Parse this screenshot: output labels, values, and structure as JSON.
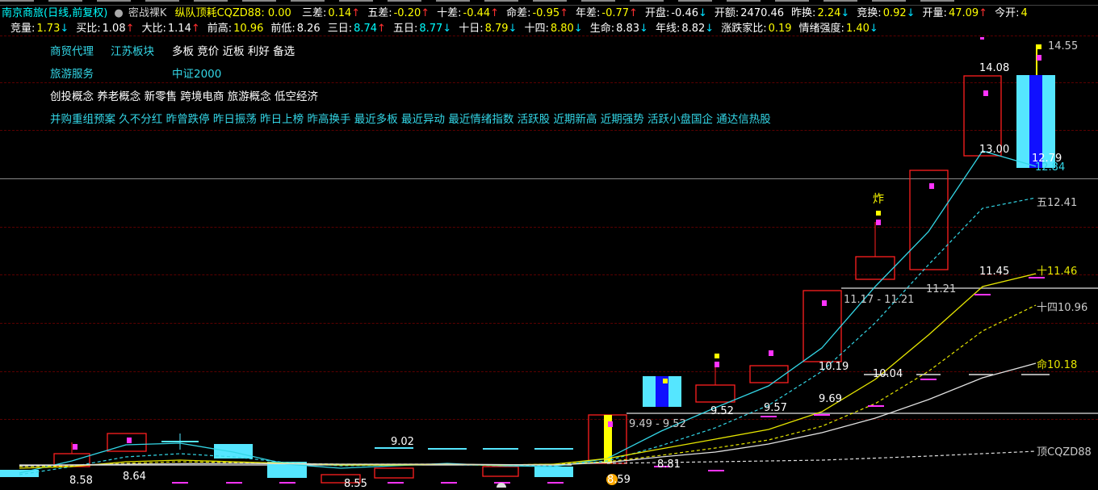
{
  "header": {
    "stock_title": "南京商旅(日线,前复权)",
    "indicator_name": "密战裸K",
    "main_metric": "纵队顶耗CQZD88: 0.00"
  },
  "stats_row1": [
    {
      "label": "三差:",
      "value": "0.14",
      "arrow": "↑",
      "color": "#ffff00"
    },
    {
      "label": "五差:",
      "value": "-0.20",
      "arrow": "↑",
      "color": "#ffff00"
    },
    {
      "label": "十差:",
      "value": "-0.44",
      "arrow": "↑",
      "color": "#ffff00"
    },
    {
      "label": "命差:",
      "value": "-0.95",
      "arrow": "↑",
      "color": "#ffff00"
    },
    {
      "label": "年差:",
      "value": "-0.77",
      "arrow": "↑",
      "color": "#ffff00"
    },
    {
      "label": "开盘:",
      "value": "-0.46",
      "arrow": "↓",
      "color": "#ffffff"
    },
    {
      "label": "开额:",
      "value": "2470.46",
      "arrow": "",
      "color": "#ffffff"
    },
    {
      "label": "昨换:",
      "value": "2.24",
      "arrow": "↓",
      "color": "#ffff00"
    },
    {
      "label": "竞换:",
      "value": "0.92",
      "arrow": "↓",
      "color": "#ffff00"
    },
    {
      "label": "开量:",
      "value": "47.09",
      "arrow": "↑",
      "color": "#ffff00"
    },
    {
      "label": "今开:",
      "value": "4",
      "arrow": "",
      "color": "#ffff00"
    }
  ],
  "stats_row2": [
    {
      "label": "竞量:",
      "value": "1.73",
      "arrow": "↓",
      "color": "#ffff00"
    },
    {
      "label": "买比:",
      "value": "1.08",
      "arrow": "↑",
      "color": "#ffffff"
    },
    {
      "label": "大比:",
      "value": "1.14",
      "arrow": "↑",
      "color": "#ffffff"
    },
    {
      "label": "前高:",
      "value": "10.96",
      "arrow": "",
      "color": "#ffff00"
    },
    {
      "label": "前低:",
      "value": "8.26",
      "arrow": "",
      "color": "#ffffff"
    },
    {
      "label": "三日:",
      "value": "8.74",
      "arrow": "↑",
      "color": "#00ffff"
    },
    {
      "label": "五日:",
      "value": "8.77",
      "arrow": "↓",
      "color": "#00ffff"
    },
    {
      "label": "十日:",
      "value": "8.79",
      "arrow": "↓",
      "color": "#ffff00"
    },
    {
      "label": "十四:",
      "value": "8.80",
      "arrow": "↓",
      "color": "#ffff00"
    },
    {
      "label": "生命:",
      "value": "8.83",
      "arrow": "↓",
      "color": "#ffffff"
    },
    {
      "label": "年线:",
      "value": "8.82",
      "arrow": "↓",
      "color": "#ffffff"
    },
    {
      "label": "涨跌家比:",
      "value": "0.19",
      "arrow": "",
      "color": "#ffff00"
    },
    {
      "label": "情绪强度:",
      "value": "1.40",
      "arrow": "↓",
      "color": "#ffff00"
    }
  ],
  "tags": {
    "industry": "商贸代理",
    "region": "江苏板块",
    "features": "多板 竞价 近板 利好 备选",
    "sector": "旅游服务",
    "index": "中证2000",
    "concepts": "创投概念 养老概念 新零售 跨境电商 旅游概念 低空经济",
    "hot": "并购重组预案 久不分红 昨曾跌停 昨日振荡 昨日上榜 昨高换手 最近多板 最近异动 最近情绪指数 活跃股 近期新高 近期强势 活跃小盘国企 通达信热股"
  },
  "price_labels": [
    {
      "id": "p1",
      "text": "14.55"
    },
    {
      "id": "p2",
      "text": "14.08"
    },
    {
      "id": "p3",
      "text": "13.00"
    },
    {
      "id": "p4",
      "text": "12.79"
    },
    {
      "id": "p5",
      "text": "12.84"
    },
    {
      "id": "p6",
      "text": "五12.41"
    },
    {
      "id": "p7",
      "text": "11.45"
    },
    {
      "id": "p8",
      "text": "十11.46"
    },
    {
      "id": "p9",
      "text": "11.17 - 11.21"
    },
    {
      "id": "p10",
      "text": "11.21"
    },
    {
      "id": "p11",
      "text": "十四10.96"
    },
    {
      "id": "p12",
      "text": "10.19"
    },
    {
      "id": "p13",
      "text": "10.04"
    },
    {
      "id": "p14",
      "text": "命10.18"
    },
    {
      "id": "p15",
      "text": "9.69"
    },
    {
      "id": "p16",
      "text": "9.57"
    },
    {
      "id": "p17",
      "text": "9.52"
    },
    {
      "id": "p18",
      "text": "9.49 - 9.52"
    },
    {
      "id": "p19",
      "text": "9.02"
    },
    {
      "id": "p20",
      "text": "8.81"
    },
    {
      "id": "p21",
      "text": "顶CQZD88"
    },
    {
      "id": "p22",
      "text": "8.58"
    },
    {
      "id": "p23",
      "text": "8.64"
    },
    {
      "id": "p24",
      "text": "8.55"
    },
    {
      "id": "p25",
      "text": "8.59"
    },
    {
      "id": "p26",
      "text": "炸"
    }
  ],
  "colors": {
    "up": "#ff2020",
    "down_fill": "#55e6ff",
    "limit_up": "#ffff00",
    "ma_cyan": "#33d6e6",
    "ma_yellow": "#e6e600",
    "ma_white": "#e0e0e0",
    "marker": "#ff33ff"
  }
}
